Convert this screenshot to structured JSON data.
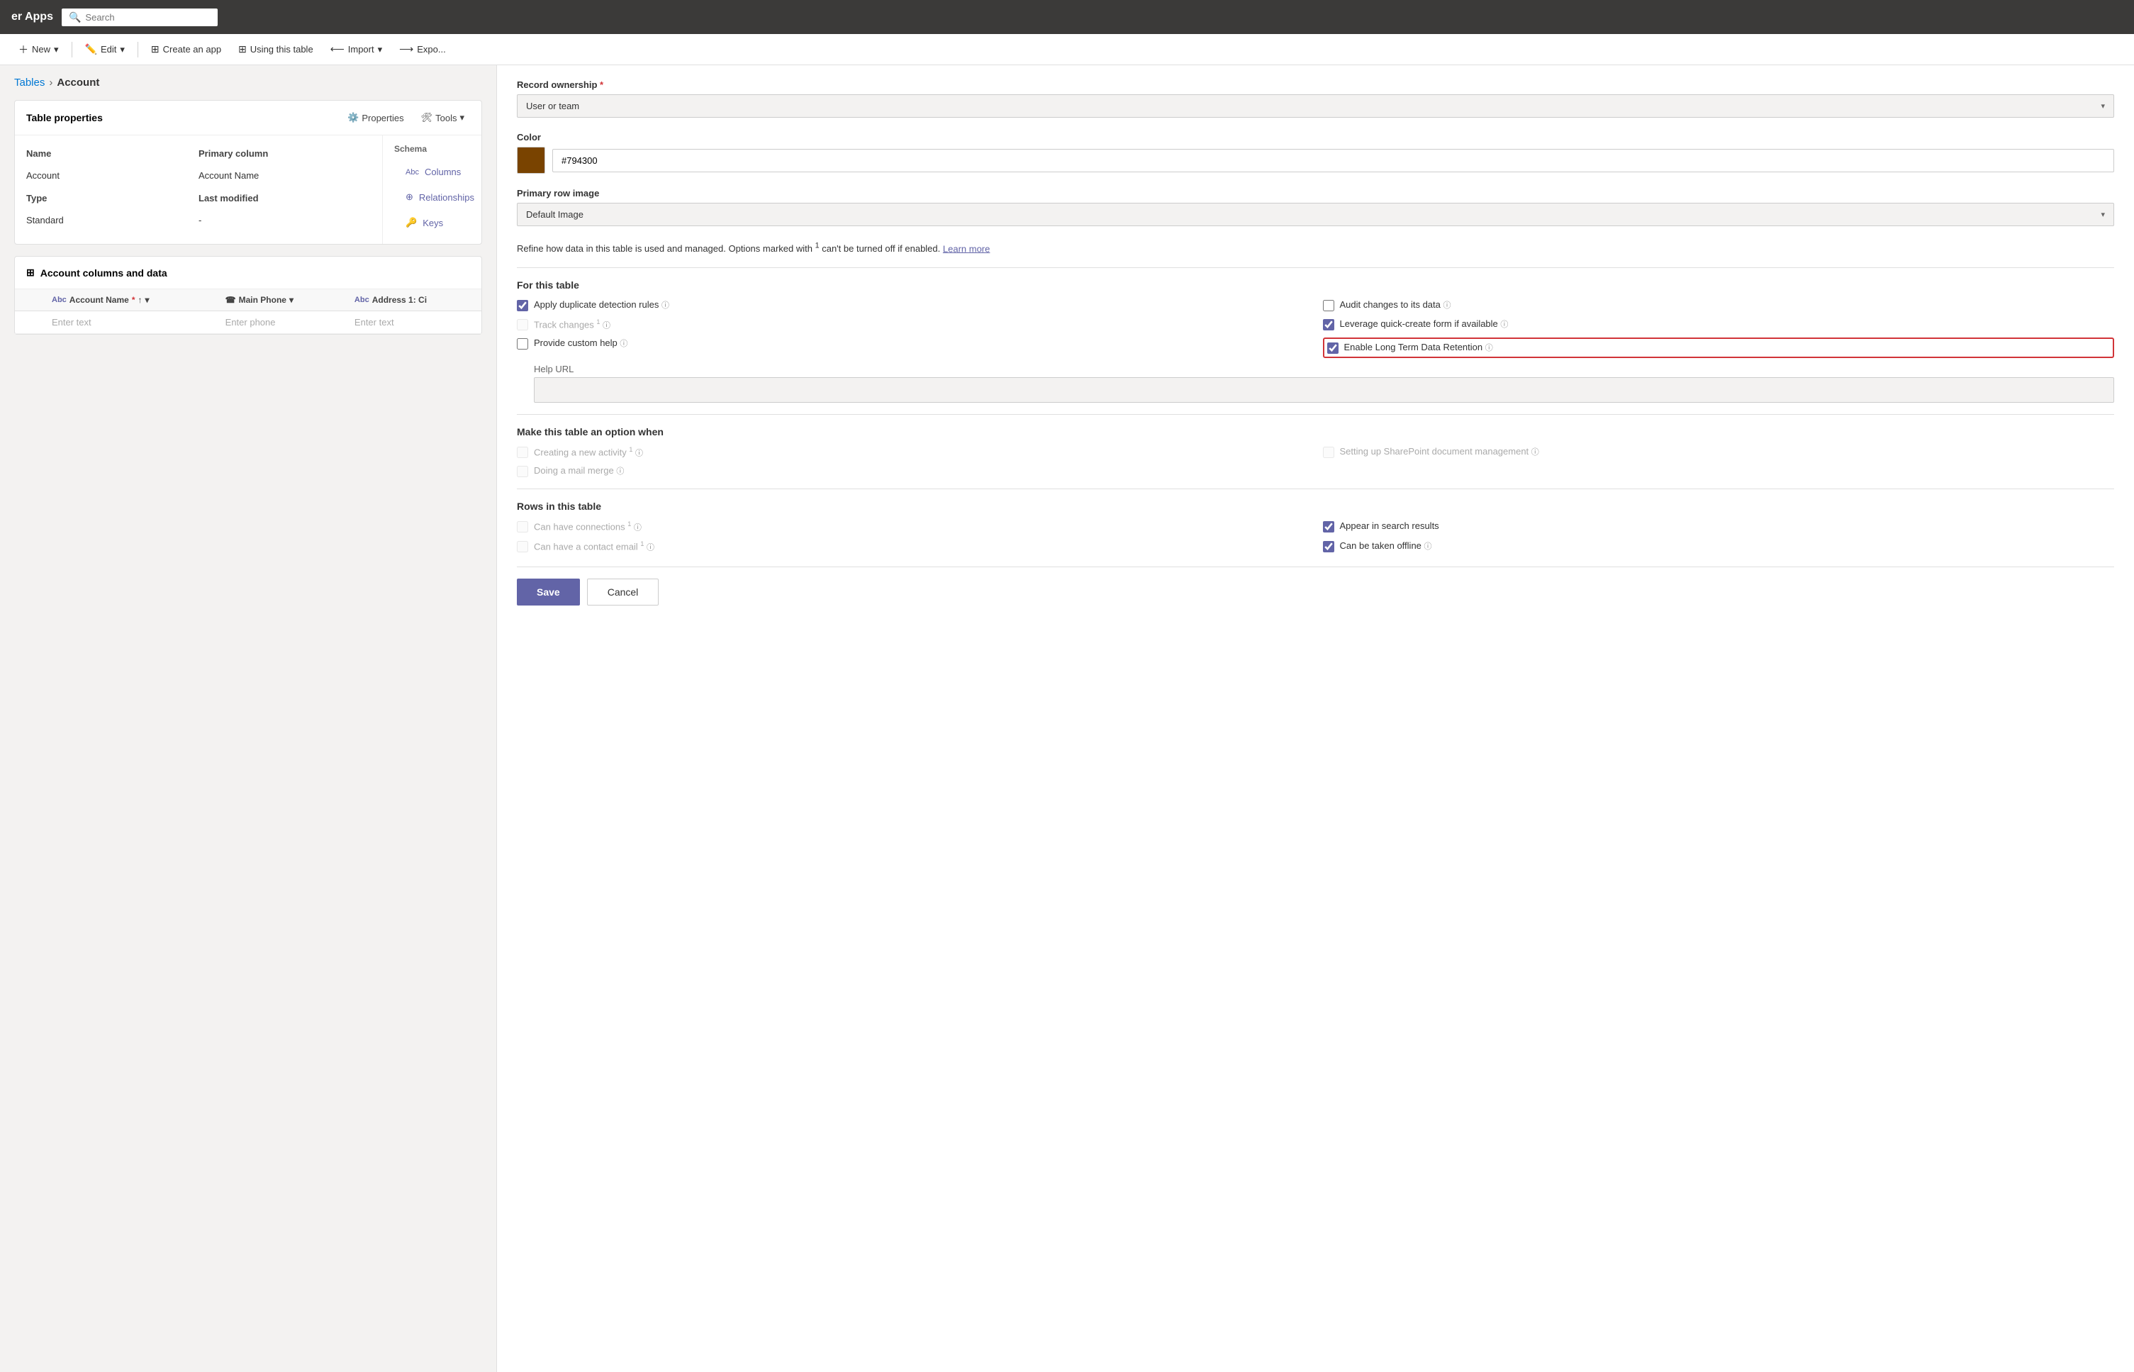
{
  "topNav": {
    "title": "er Apps",
    "searchPlaceholder": "Search"
  },
  "toolbar": {
    "newLabel": "New",
    "editLabel": "Edit",
    "createAppLabel": "Create an app",
    "usingTableLabel": "Using this table",
    "importLabel": "Import",
    "exportLabel": "Expo..."
  },
  "breadcrumb": {
    "parent": "Tables",
    "current": "Account"
  },
  "tableProperties": {
    "title": "Table properties",
    "propertiesBtn": "Properties",
    "toolsBtn": "Tools",
    "nameLabel": "Name",
    "nameValue": "Account",
    "typeLabel": "Type",
    "typeValue": "Standard",
    "primaryColumnLabel": "Primary column",
    "primaryColumnValue": "Account Name",
    "lastModifiedLabel": "Last modified",
    "lastModifiedValue": "-"
  },
  "schema": {
    "label": "Schema",
    "items": [
      {
        "id": "columns",
        "label": "Columns",
        "icon": "Abc"
      },
      {
        "id": "relationships",
        "label": "Relationships",
        "icon": "⊕"
      },
      {
        "id": "keys",
        "label": "Keys",
        "icon": "🔑"
      }
    ]
  },
  "dataSection": {
    "title": "Account columns and data",
    "columns": [
      {
        "label": "Account Name",
        "icon": "Abc",
        "required": true,
        "sortable": true
      },
      {
        "label": "Main Phone",
        "icon": "☎"
      },
      {
        "label": "Address 1: Ci",
        "icon": "Abc"
      }
    ],
    "placeholders": [
      "Enter text",
      "Enter phone",
      "Enter text"
    ]
  },
  "rightPanel": {
    "recordOwnership": {
      "label": "Record ownership",
      "required": true,
      "value": "User or team"
    },
    "color": {
      "label": "Color",
      "hex": "#794300",
      "swatchColor": "#794300"
    },
    "primaryRowImage": {
      "label": "Primary row image",
      "value": "Default Image"
    },
    "infoText": "Refine how data in this table is used and managed. Options marked with",
    "infoText2": " can't be turned off if enabled.",
    "learnMoreLabel": "Learn more",
    "forThisTable": {
      "heading": "For this table",
      "options": [
        {
          "id": "duplicate-detection",
          "label": "Apply duplicate detection rules",
          "checked": true,
          "disabled": false,
          "superscript": ""
        },
        {
          "id": "audit-changes",
          "label": "Audit changes to its data",
          "checked": false,
          "disabled": false,
          "superscript": ""
        },
        {
          "id": "track-changes",
          "label": "Track changes",
          "checked": false,
          "disabled": true,
          "superscript": "1"
        },
        {
          "id": "leverage-quick-create",
          "label": "Leverage quick-create form if available",
          "checked": true,
          "disabled": false,
          "superscript": ""
        },
        {
          "id": "provide-custom-help",
          "label": "Provide custom help",
          "checked": false,
          "disabled": false,
          "superscript": ""
        },
        {
          "id": "enable-long-term",
          "label": "Enable Long Term Data Retention",
          "checked": true,
          "disabled": false,
          "superscript": "",
          "highlighted": true
        }
      ],
      "helpUrlLabel": "Help URL",
      "helpUrlPlaceholder": ""
    },
    "makeOptionWhen": {
      "heading": "Make this table an option when",
      "options": [
        {
          "id": "creating-activity",
          "label": "Creating a new activity",
          "checked": false,
          "disabled": true,
          "superscript": "1"
        },
        {
          "id": "sharepoint-mgmt",
          "label": "Setting up SharePoint document management",
          "checked": false,
          "disabled": true,
          "superscript": ""
        },
        {
          "id": "mail-merge",
          "label": "Doing a mail merge",
          "checked": false,
          "disabled": true,
          "superscript": ""
        }
      ]
    },
    "rowsInTable": {
      "heading": "Rows in this table",
      "options": [
        {
          "id": "can-have-connections",
          "label": "Can have connections",
          "checked": false,
          "disabled": true,
          "superscript": "1"
        },
        {
          "id": "appear-search",
          "label": "Appear in search results",
          "checked": true,
          "disabled": false,
          "superscript": ""
        },
        {
          "id": "can-have-contact-email",
          "label": "Can have a contact email",
          "checked": false,
          "disabled": true,
          "superscript": "1"
        },
        {
          "id": "can-be-taken-offline",
          "label": "Can be taken offline",
          "checked": true,
          "disabled": false,
          "superscript": ""
        }
      ]
    },
    "saveLabel": "Save",
    "cancelLabel": "Cancel"
  }
}
